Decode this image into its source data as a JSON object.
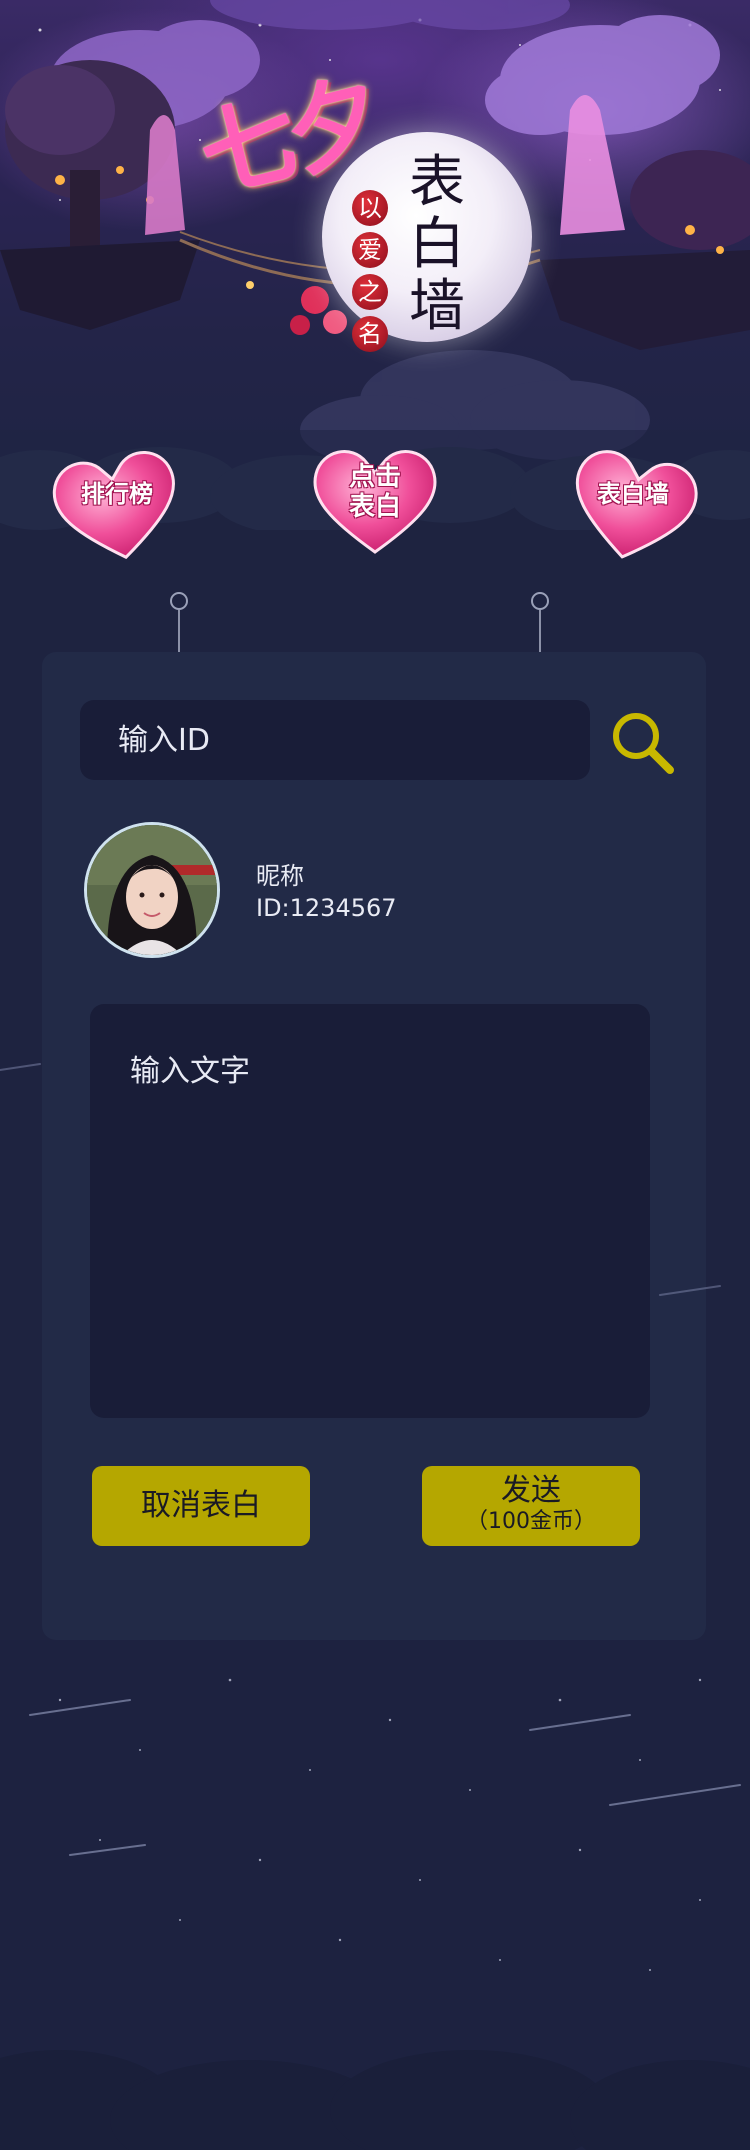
{
  "banner": {
    "title_qixi": "七夕",
    "tagline_chars": [
      "以",
      "爱",
      "之",
      "名"
    ],
    "title_wall_chars": [
      "表",
      "白",
      "墙"
    ]
  },
  "nav": {
    "ranking": {
      "label": "排行榜"
    },
    "confess": {
      "label_line1": "点击",
      "label_line2": "表白"
    },
    "wall": {
      "label": "表白墙"
    }
  },
  "search": {
    "placeholder": "输入ID",
    "value": "",
    "icon": "search-icon"
  },
  "profile": {
    "nickname": "昵称",
    "id_text": "ID:1234567",
    "avatar": "avatar-photo"
  },
  "message": {
    "placeholder": "输入文字",
    "value": ""
  },
  "actions": {
    "cancel_label": "取消表白",
    "send_label": "发送",
    "send_cost": "（100金币）"
  },
  "colors": {
    "background": "#1e2340",
    "card": "#222a47",
    "field": "#191d38",
    "button": "#b5a700",
    "search_icon": "#c8b800",
    "heart": "#f04f9a"
  }
}
